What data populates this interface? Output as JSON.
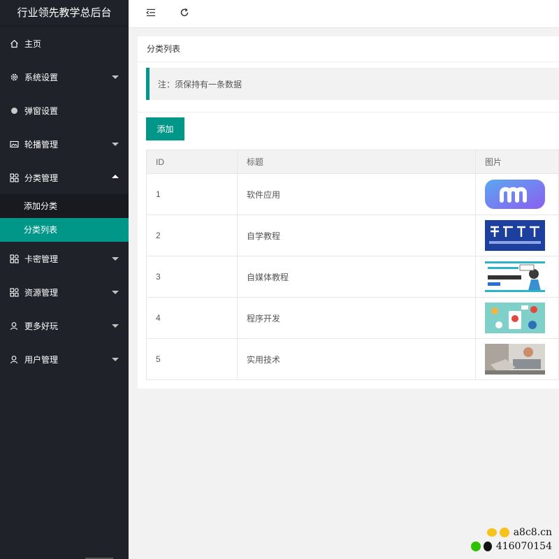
{
  "app": {
    "title": "行业领先教学总后台"
  },
  "sidebar": {
    "items": [
      {
        "label": "主页",
        "icon": "home-icon"
      },
      {
        "label": "系统设置",
        "icon": "gear-icon"
      },
      {
        "label": "弹窗设置",
        "icon": "dot-icon"
      },
      {
        "label": "轮播管理",
        "icon": "image-icon"
      },
      {
        "label": "分类管理",
        "icon": "apps-icon"
      },
      {
        "label": "卡密管理",
        "icon": "apps-icon"
      },
      {
        "label": "资源管理",
        "icon": "apps-icon"
      },
      {
        "label": "更多好玩",
        "icon": "user-icon"
      },
      {
        "label": "用户管理",
        "icon": "user-icon"
      }
    ],
    "submenu": [
      {
        "label": "添加分类"
      },
      {
        "label": "分类列表"
      }
    ]
  },
  "topbar": {
    "icons": [
      "collapse-menu-icon",
      "refresh-icon"
    ]
  },
  "card": {
    "title": "分类列表",
    "note": "注：须保持有一条数据",
    "add_label": "添加"
  },
  "table": {
    "headers": [
      "ID",
      "标题",
      "图片"
    ],
    "rows": [
      {
        "id": "1",
        "title": "软件应用"
      },
      {
        "id": "2",
        "title": "自学教程"
      },
      {
        "id": "3",
        "title": "自媒体教程"
      },
      {
        "id": "4",
        "title": "程序开发"
      },
      {
        "id": "5",
        "title": "实用技术"
      }
    ]
  },
  "watermark": {
    "site": "a8c8.cn",
    "qq": "416070154"
  },
  "colors": {
    "accent": "#009688",
    "sidebar": "#20222a"
  }
}
